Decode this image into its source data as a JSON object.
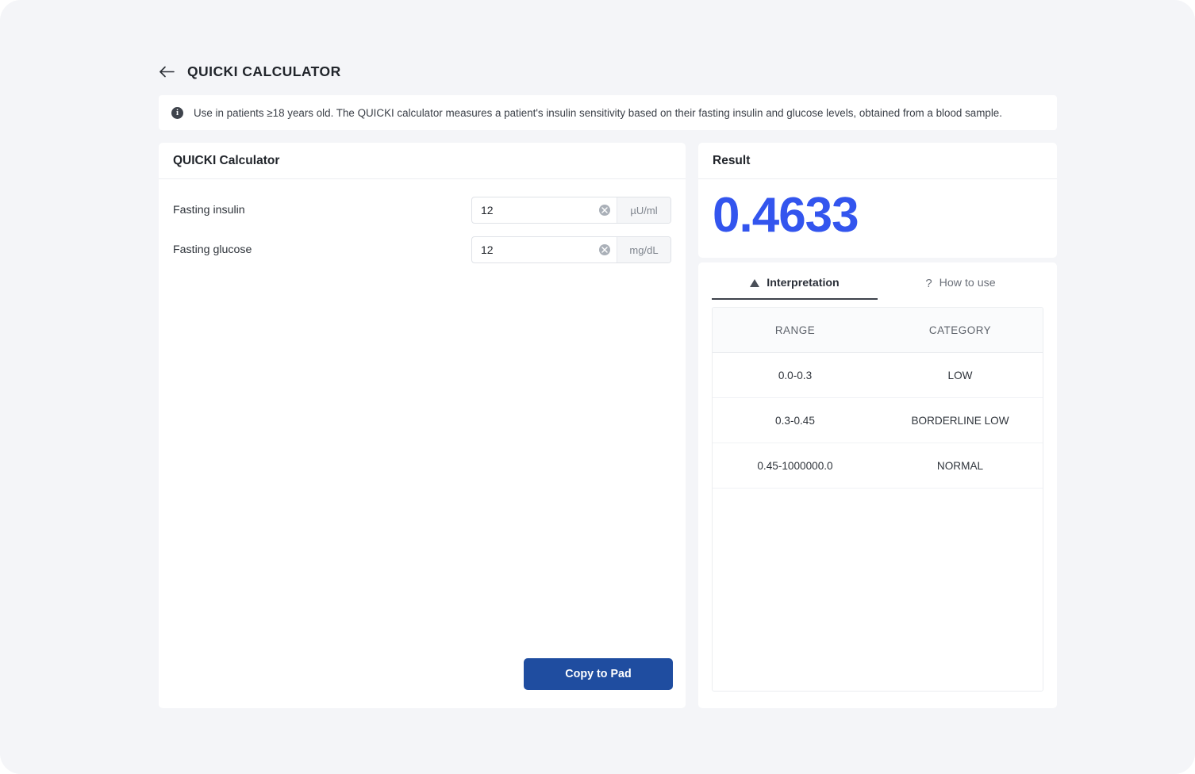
{
  "header": {
    "back_icon": "arrow-left-icon",
    "title": "QUICKI CALCULATOR"
  },
  "banner": {
    "icon": "info-icon",
    "text": "Use in patients ≥18 years old. The QUICKI calculator measures a patient's insulin sensitivity based on their fasting insulin and glucose levels, obtained from a blood sample."
  },
  "calculator": {
    "card_title": "QUICKI Calculator",
    "fields": [
      {
        "label": "Fasting insulin",
        "value": "12",
        "placeholder": "",
        "unit": "µU/ml",
        "clear_icon": "clear-circle-icon"
      },
      {
        "label": "Fasting glucose",
        "value": "12",
        "placeholder": "",
        "unit": "mg/dL",
        "clear_icon": "clear-circle-icon"
      }
    ],
    "copy_button": "Copy to Pad"
  },
  "result": {
    "card_title": "Result",
    "value": "0.4633",
    "color": "#3355ee"
  },
  "tabs": [
    {
      "label": "Interpretation",
      "icon": "warning-triangle-icon",
      "active": true
    },
    {
      "label": "How to use",
      "icon": "question-mark-icon",
      "active": false
    }
  ],
  "interpretation_table": {
    "columns": [
      "RANGE",
      "CATEGORY"
    ],
    "rows": [
      [
        "0.0-0.3",
        "LOW"
      ],
      [
        "0.3-0.45",
        "BORDERLINE LOW"
      ],
      [
        "0.45-1000000.0",
        "NORMAL"
      ]
    ]
  },
  "theme": {
    "page_background": "#f4f5f8",
    "card_background": "#ffffff",
    "accent_blue": "#3355ee",
    "button_blue": "#1f4da0"
  }
}
